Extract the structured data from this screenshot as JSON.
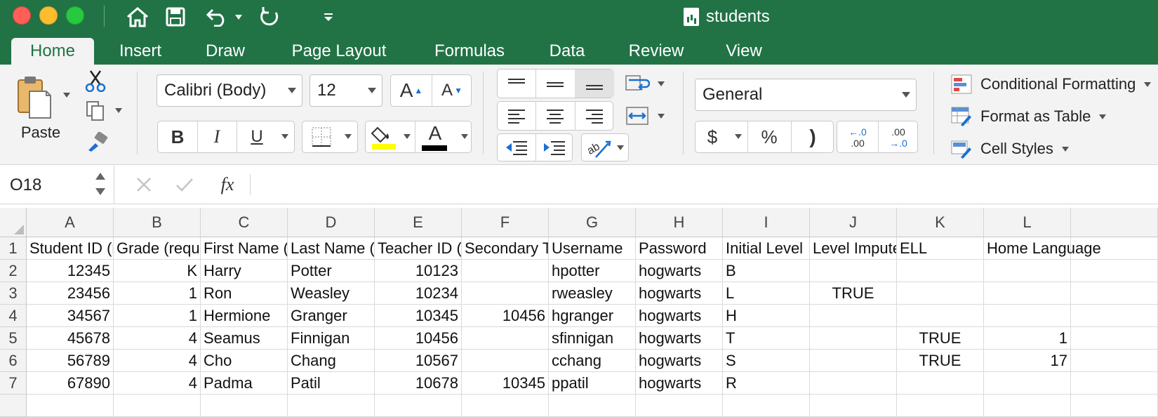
{
  "window": {
    "title": "students"
  },
  "tabs": [
    "Home",
    "Insert",
    "Draw",
    "Page Layout",
    "Formulas",
    "Data",
    "Review",
    "View"
  ],
  "clipboard": {
    "paste_label": "Paste"
  },
  "font": {
    "name": "Calibri (Body)",
    "size": "12",
    "bold": "B",
    "italic": "I",
    "underline": "U",
    "grow": "A",
    "shrink": "A",
    "color_glyph": "A",
    "highlight_color": "#ffff00",
    "font_color": "#000000"
  },
  "number": {
    "format": "General",
    "currency": "$",
    "percent": "%",
    "comma": ")",
    "inc_decimal_top": "←.0",
    "inc_decimal_bottom": ".00",
    "dec_decimal_top": ".00",
    "dec_decimal_bottom": "→.0"
  },
  "styles": {
    "conditional": "Conditional Formatting",
    "format_table": "Format as Table",
    "cell_styles": "Cell Styles"
  },
  "formula_bar": {
    "name_box": "O18",
    "fx": "fx",
    "value": ""
  },
  "sheet": {
    "columns": [
      "A",
      "B",
      "C",
      "D",
      "E",
      "F",
      "G",
      "H",
      "I",
      "J",
      "K",
      "L"
    ],
    "rows": [
      "1",
      "2",
      "3",
      "4",
      "5",
      "6",
      "7",
      ""
    ],
    "cells": [
      [
        "Student ID (r",
        "Grade (requi",
        "First Name (",
        "Last Name (r",
        "Teacher ID (r",
        "Secondary Te",
        "Username",
        "Password",
        "Initial Level",
        "Level Impute",
        "ELL",
        "Home Language"
      ],
      [
        "12345",
        "K",
        "Harry",
        "Potter",
        "10123",
        "",
        "hpotter",
        "hogwarts",
        "B",
        "",
        "",
        ""
      ],
      [
        "23456",
        "1",
        "Ron",
        "Weasley",
        "10234",
        "",
        "rweasley",
        "hogwarts",
        "L",
        "TRUE",
        "",
        ""
      ],
      [
        "34567",
        "1",
        "Hermione",
        "Granger",
        "10345",
        "10456",
        "hgranger",
        "hogwarts",
        "H",
        "",
        "",
        ""
      ],
      [
        "45678",
        "4",
        "Seamus",
        "Finnigan",
        "10456",
        "",
        "sfinnigan",
        "hogwarts",
        "T",
        "",
        "TRUE",
        "1"
      ],
      [
        "56789",
        "4",
        "Cho",
        "Chang",
        "10567",
        "",
        "cchang",
        "hogwarts",
        "S",
        "",
        "TRUE",
        "17"
      ],
      [
        "67890",
        "4",
        "Padma",
        "Patil",
        "10678",
        "10345",
        "ppatil",
        "hogwarts",
        "R",
        "",
        "",
        ""
      ]
    ]
  }
}
